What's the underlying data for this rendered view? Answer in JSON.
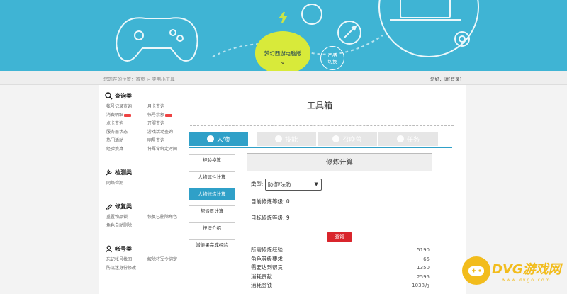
{
  "banner": {
    "brand": "梦幻西游电脑版",
    "product_line1": "产品",
    "product_line2": "切换"
  },
  "topstrip": {
    "breadcrumb": "您现在的位置：首页 > 实用小工具",
    "user": "您好，请[登录]"
  },
  "sidebar": {
    "sections": [
      {
        "title": "查询类",
        "icon": "magnifier-icon",
        "items": [
          "帐号记录查询",
          "月卡查询",
          "消费明细",
          "帐号余额",
          "点卡查询",
          "开服查询",
          "服务器状态",
          "游戏活动查询",
          "热门活动",
          "明星查询",
          "经验换算",
          "将军令绑定时间"
        ]
      },
      {
        "title": "检测类",
        "icon": "wrench-icon",
        "items": [
          "网络检测"
        ]
      },
      {
        "title": "修复类",
        "icon": "pencil-icon",
        "items": [
          "重置物品锁",
          "恢复已删除角色",
          "角色自动删除"
        ]
      },
      {
        "title": "帐号类",
        "icon": "user-icon",
        "items": [
          "忘记帐号找回",
          "解除将军令绑定",
          "防沉迷身份修改"
        ]
      }
    ]
  },
  "main": {
    "title": "工具箱",
    "tabs": [
      "人物",
      "技能",
      "召唤兽",
      "任务"
    ],
    "side_buttons": [
      "经验换算",
      "人物属性计算",
      "人物修炼计算",
      "帮派贡计算",
      "技法介绍",
      "潜能果完成经验"
    ],
    "panel": {
      "heading": "修炼计算",
      "type_label": "类型:",
      "type_value": "防御/法防",
      "current_label": "目前修炼等级:",
      "current_value": "0",
      "target_label": "目标修炼等级:",
      "target_value": "9",
      "query_label": "查询",
      "results": [
        {
          "label": "所需修炼经验",
          "value": "5190"
        },
        {
          "label": "角色等级要求",
          "value": "65"
        },
        {
          "label": "需要达到帮贡",
          "value": "1350"
        },
        {
          "label": "消耗贡献",
          "value": "2595"
        },
        {
          "label": "消耗金钱",
          "value": "1038万"
        }
      ]
    }
  },
  "watermark": {
    "text": "DVG游戏网",
    "sub": "www.dvgo.com"
  },
  "colors": {
    "banner": "#3fb4d4",
    "accent": "#2fa0c8",
    "badge": "#d8ea3a",
    "query": "#d9252c",
    "watermark": "#f2bc1c"
  }
}
